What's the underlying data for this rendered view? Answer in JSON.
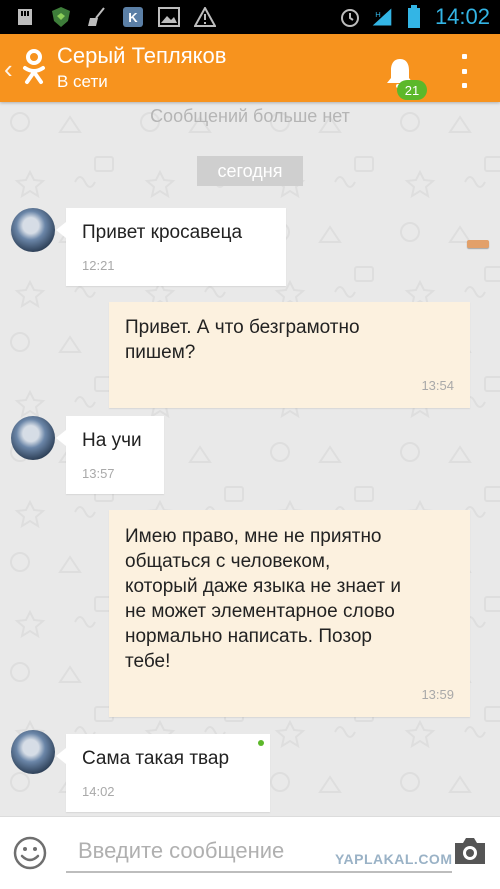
{
  "status_bar": {
    "time": "14:02",
    "icons": [
      "sd-card-icon",
      "shield-icon",
      "broom-icon",
      "vk-icon",
      "image-icon",
      "warning-icon",
      "alarm-icon",
      "signal-icon",
      "battery-icon"
    ]
  },
  "header": {
    "contact_name": "Серый Тепляков",
    "status": "В сети",
    "notifications_count": "21",
    "colors": {
      "bar": "#f7931e",
      "badge": "#5cb82a"
    }
  },
  "chat": {
    "no_more_messages": "Сообщений больше нет",
    "date_label": "сегодня",
    "messages": [
      {
        "direction": "in",
        "text": "Привет кросавеца",
        "time": "12:21"
      },
      {
        "direction": "out",
        "text": "Привет. А что безграмотно\nпишем?",
        "time": "13:54"
      },
      {
        "direction": "in",
        "text": "На учи",
        "time": "13:57"
      },
      {
        "direction": "out",
        "text": "Имею право, мне не приятно\nобщаться с человеком,\nкоторый даже языка не знает и\nне может элементарное слово\nнормально написать. Позор\nтебе!",
        "time": "13:59"
      },
      {
        "direction": "in",
        "text": "Сама такая твар",
        "time": "14:02"
      }
    ]
  },
  "composer": {
    "placeholder": "Введите сообщение",
    "value": ""
  },
  "watermark": "YAPLAKAL.COM"
}
